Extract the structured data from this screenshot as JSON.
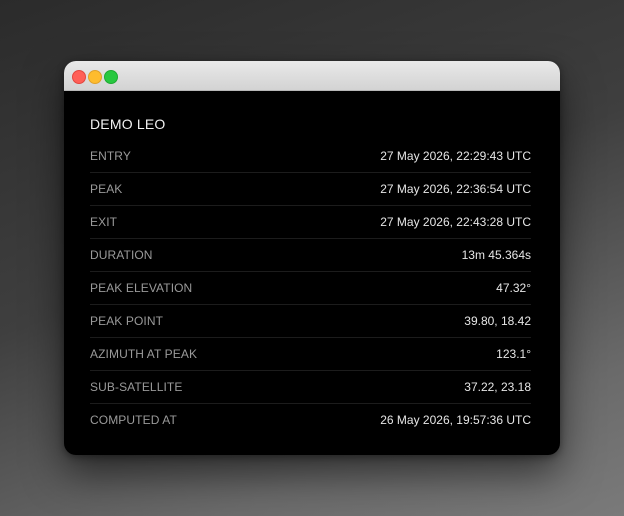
{
  "window": {
    "title": ""
  },
  "pass": {
    "title": "DEMO LEO",
    "rows": [
      {
        "label": "ENTRY",
        "value": "27 May 2026, 22:29:43 UTC"
      },
      {
        "label": "PEAK",
        "value": "27 May 2026, 22:36:54 UTC"
      },
      {
        "label": "EXIT",
        "value": "27 May 2026, 22:43:28 UTC"
      },
      {
        "label": "DURATION",
        "value": "13m 45.364s"
      },
      {
        "label": "PEAK ELEVATION",
        "value": "47.32°"
      },
      {
        "label": "PEAK POINT",
        "value": "39.80, 18.42"
      },
      {
        "label": "AZIMUTH AT PEAK",
        "value": "123.1°"
      },
      {
        "label": "SUB-SATELLITE",
        "value": "37.22, 23.18"
      },
      {
        "label": "COMPUTED AT",
        "value": "26 May 2026, 19:57:36 UTC"
      }
    ]
  },
  "colors": {
    "close": "#ff5f57",
    "minimize": "#febc2e",
    "maximize": "#28c840",
    "panel_background": "#000000"
  }
}
